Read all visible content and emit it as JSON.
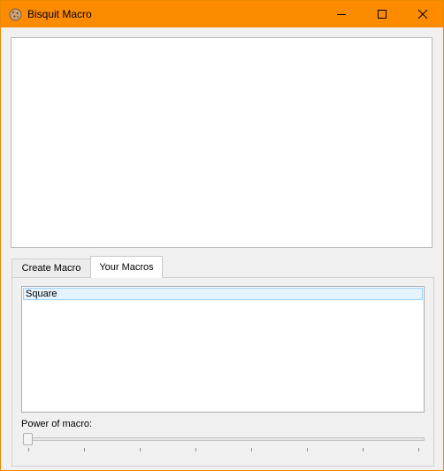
{
  "window": {
    "title": "Bisquit Macro",
    "app_icon": "cookie-icon",
    "titlebar_color": "#fd8b00",
    "controls": {
      "minimize_icon": "minimize-icon",
      "maximize_icon": "maximize-icon",
      "close_icon": "close-icon"
    }
  },
  "tabs": [
    {
      "label": "Create Macro",
      "selected": false
    },
    {
      "label": "Your Macros",
      "selected": true
    }
  ],
  "macros": {
    "items": [
      {
        "label": "Square",
        "selected": true
      }
    ]
  },
  "power": {
    "label": "Power of macro:",
    "value_fraction": 0.0
  }
}
